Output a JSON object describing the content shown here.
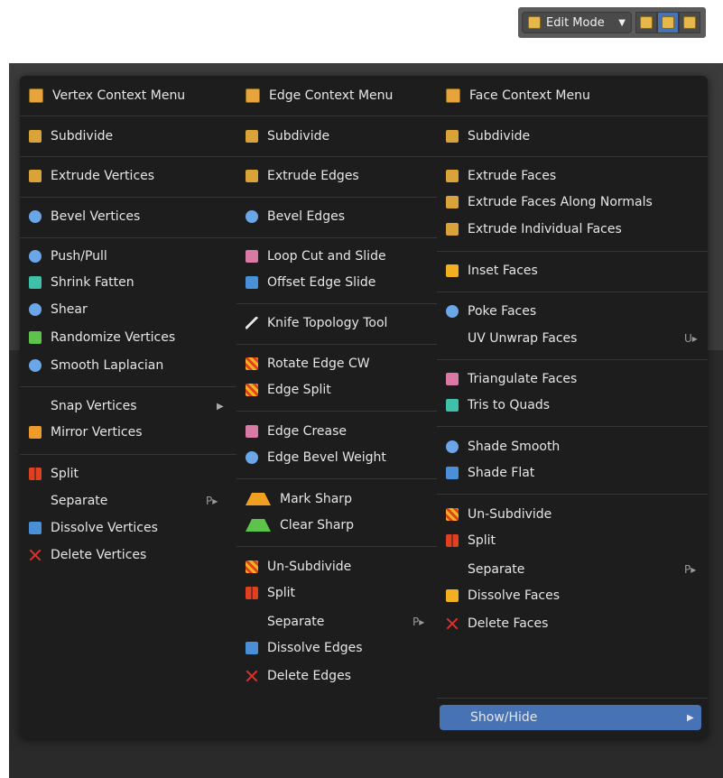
{
  "header": {
    "mode_label": "Edit Mode",
    "select_modes": [
      "vertex-select-icon",
      "edge-select-icon",
      "face-select-icon"
    ]
  },
  "menu": {
    "vertex": {
      "title": "Vertex Context Menu",
      "items": [
        "Subdivide",
        "Extrude Vertices",
        "Bevel Vertices",
        "Push/Pull",
        "Shrink Fatten",
        "Shear",
        "Randomize Vertices",
        "Smooth Laplacian",
        "Snap Vertices",
        "Mirror Vertices",
        "Split",
        "Separate",
        "Dissolve Vertices",
        "Delete Vertices"
      ],
      "separate_shortcut": "P▸"
    },
    "edge": {
      "title": "Edge Context Menu",
      "items": [
        "Subdivide",
        "Extrude Edges",
        "Bevel Edges",
        "Loop Cut and Slide",
        "Offset Edge Slide",
        "Knife Topology Tool",
        "Rotate Edge CW",
        "Edge Split",
        "Edge Crease",
        "Edge Bevel Weight",
        "Mark Sharp",
        "Clear Sharp",
        "Un-Subdivide",
        "Split",
        "Separate",
        "Dissolve Edges",
        "Delete Edges"
      ],
      "separate_shortcut": "P▸"
    },
    "face": {
      "title": "Face Context Menu",
      "items": [
        "Subdivide",
        "Extrude Faces",
        "Extrude Faces Along Normals",
        "Extrude Individual Faces",
        "Inset Faces",
        "Poke Faces",
        "UV Unwrap Faces",
        "Triangulate Faces",
        "Tris to Quads",
        "Shade Smooth",
        "Shade Flat",
        "Un-Subdivide",
        "Split",
        "Separate",
        "Dissolve Faces",
        "Delete Faces",
        "Show/Hide"
      ],
      "uv_shortcut": "U▸",
      "separate_shortcut": "P▸"
    }
  },
  "colors": {
    "menu_bg": "#1d1d1d",
    "highlight": "#4772b3"
  }
}
